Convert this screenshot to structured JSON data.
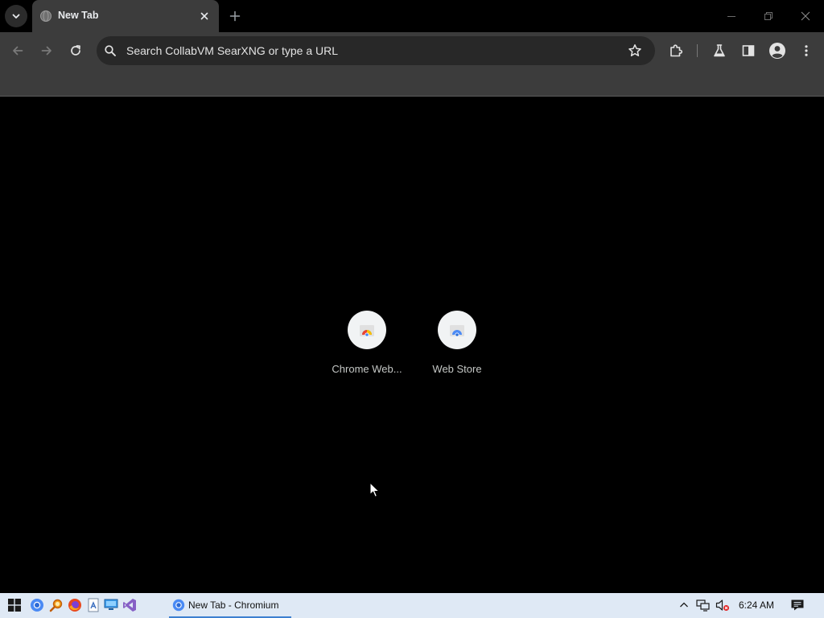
{
  "browser": {
    "tab": {
      "title": "New Tab"
    },
    "omnibox": {
      "placeholder": "Search CollabVM SearXNG or type a URL"
    }
  },
  "icons": {
    "tab_search": "chevron-down-icon",
    "new_tab": "plus-icon",
    "back": "back-arrow-icon",
    "forward": "forward-arrow-icon",
    "reload": "reload-icon",
    "bookmark": "star-icon",
    "extensions": "puzzle-icon",
    "labs": "flask-icon",
    "side_panel": "side-panel-icon",
    "profile": "avatar-icon",
    "menu": "kebab-menu-icon"
  },
  "shortcuts": [
    {
      "label": "Chrome Web..."
    },
    {
      "label": "Web Store"
    }
  ],
  "taskbar": {
    "active_task": "New Tab - Chromium",
    "clock": "6:24 AM"
  },
  "colors": {
    "frame": "#000000",
    "toolbar": "#3c3c3c",
    "omnibox": "#282828",
    "page_bg": "#000000",
    "taskbar": "#dfe9f5",
    "accent": "#3c7fd0"
  }
}
